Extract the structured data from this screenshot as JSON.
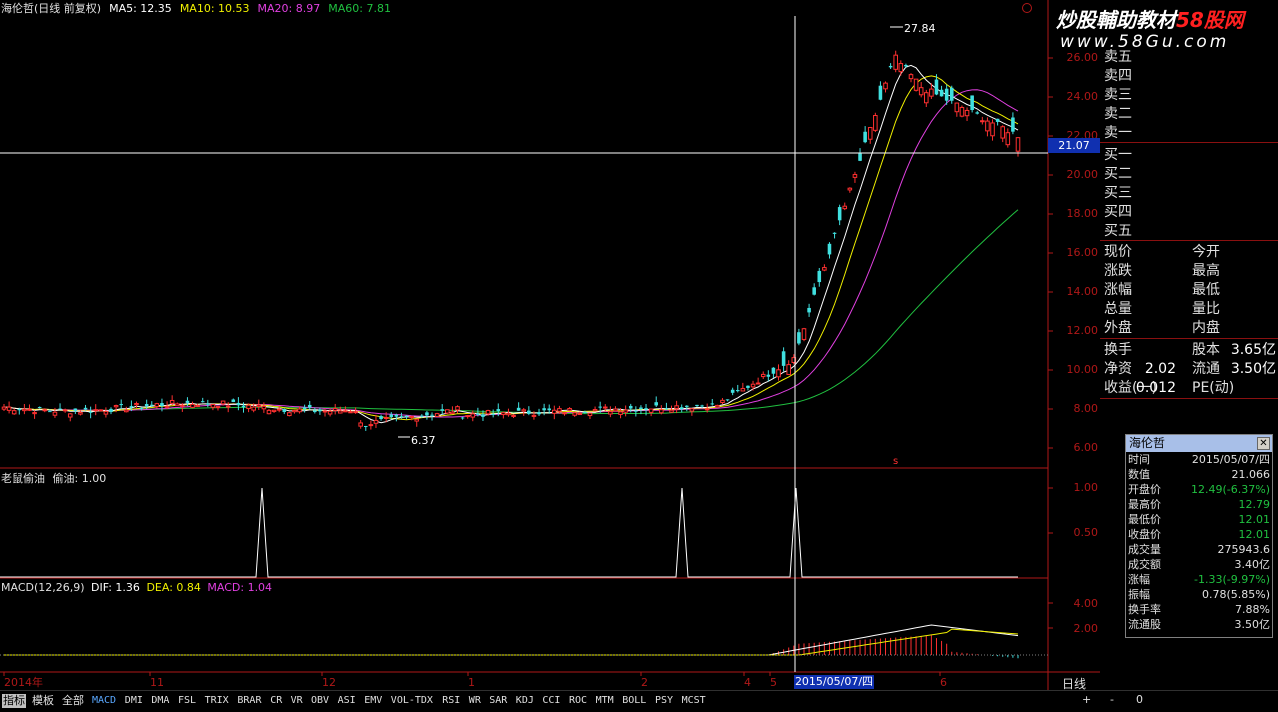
{
  "header": {
    "title": "海伦哲(日线 前复权)",
    "ma5": "MA5: 12.35",
    "ma10": "MA10: 10.53",
    "ma20": "MA20: 8.97",
    "ma60": "MA60: 7.81"
  },
  "colors": {
    "ma5": "#ffffff",
    "ma10": "#f0f000",
    "ma20": "#e040e0",
    "ma60": "#20c040",
    "up": "#ff3030",
    "down": "#40e0e0",
    "axis": "#b01818",
    "accent": "#5aa8ff"
  },
  "price_axis": [
    "26.00",
    "24.00",
    "22.00",
    "20.00",
    "18.00",
    "16.00",
    "14.00",
    "12.00",
    "10.00",
    "8.00",
    "6.00"
  ],
  "indicator_axis": [
    "1.00",
    "0.50"
  ],
  "macd_axis": [
    "4.00",
    "2.00"
  ],
  "cursor_price": "21.07",
  "annotations": {
    "high": "27.84",
    "low": "6.37",
    "marker": "s"
  },
  "panel2": {
    "title": "老鼠偷油",
    "value": "偷油: 1.00"
  },
  "panel3": {
    "title": "MACD(12,26,9)",
    "dif": "DIF: 1.36",
    "dea": "DEA: 0.84",
    "macd": "MACD: 1.04"
  },
  "x_axis": [
    "2014年",
    "11",
    "12",
    "1",
    "2",
    "4",
    "5",
    "6"
  ],
  "cursor_date": "2015/05/07/四",
  "period": "日线",
  "order_book": {
    "asks": [
      "卖五",
      "卖四",
      "卖三",
      "卖二",
      "卖一"
    ],
    "bids": [
      "买一",
      "买二",
      "买三",
      "买四",
      "买五"
    ]
  },
  "quote": {
    "rows": [
      [
        "现价",
        "今开"
      ],
      [
        "涨跌",
        "最高"
      ],
      [
        "涨幅",
        "最低"
      ],
      [
        "总量",
        "量比"
      ],
      [
        "外盘",
        "内盘"
      ]
    ],
    "fund": [
      {
        "k1": "换手",
        "v1": "",
        "k2": "股本",
        "v2": "3.65亿"
      },
      {
        "k1": "净资",
        "v1": "2.02",
        "k2": "流通",
        "v2": "3.50亿"
      },
      {
        "k1": "收益(一)",
        "v1": "0.012",
        "k2": "PE(动)",
        "v2": ""
      }
    ]
  },
  "tooltip": {
    "title": "海伦哲",
    "rows": [
      {
        "k": "时间",
        "v": "2015/05/07/四",
        "c": "#e0e0e0"
      },
      {
        "k": "数值",
        "v": "21.066",
        "c": "#e0e0e0"
      },
      {
        "k": "开盘价",
        "v": "12.49(-6.37%)",
        "c": "#20c040"
      },
      {
        "k": "最高价",
        "v": "12.79",
        "c": "#20c040"
      },
      {
        "k": "最低价",
        "v": "12.01",
        "c": "#20c040"
      },
      {
        "k": "收盘价",
        "v": "12.01",
        "c": "#20c040"
      },
      {
        "k": "成交量",
        "v": "275943.6",
        "c": "#e0e0e0"
      },
      {
        "k": "成交额",
        "v": "3.40亿",
        "c": "#e0e0e0"
      },
      {
        "k": "涨幅",
        "v": "-1.33(-9.97%)",
        "c": "#20c040"
      },
      {
        "k": "振幅",
        "v": "0.78(5.85%)",
        "c": "#e0e0e0"
      },
      {
        "k": "换手率",
        "v": "7.88%",
        "c": "#e0e0e0"
      },
      {
        "k": "流通股",
        "v": "3.50亿",
        "c": "#e0e0e0"
      }
    ]
  },
  "tabs": [
    "指标",
    "模板",
    "全部",
    "MACD",
    "DMI",
    "DMA",
    "FSL",
    "TRIX",
    "BRAR",
    "CR",
    "VR",
    "OBV",
    "ASI",
    "EMV",
    "VOL-TDX",
    "RSI",
    "WR",
    "SAR",
    "KDJ",
    "CCI",
    "ROC",
    "MTM",
    "BOLL",
    "PSY",
    "MCST"
  ],
  "nav": [
    "+",
    "-",
    "0"
  ],
  "watermark": {
    "line1": "炒股輔助教材",
    "line1b": "58股网",
    "line2": "www.58Gu.com"
  }
}
